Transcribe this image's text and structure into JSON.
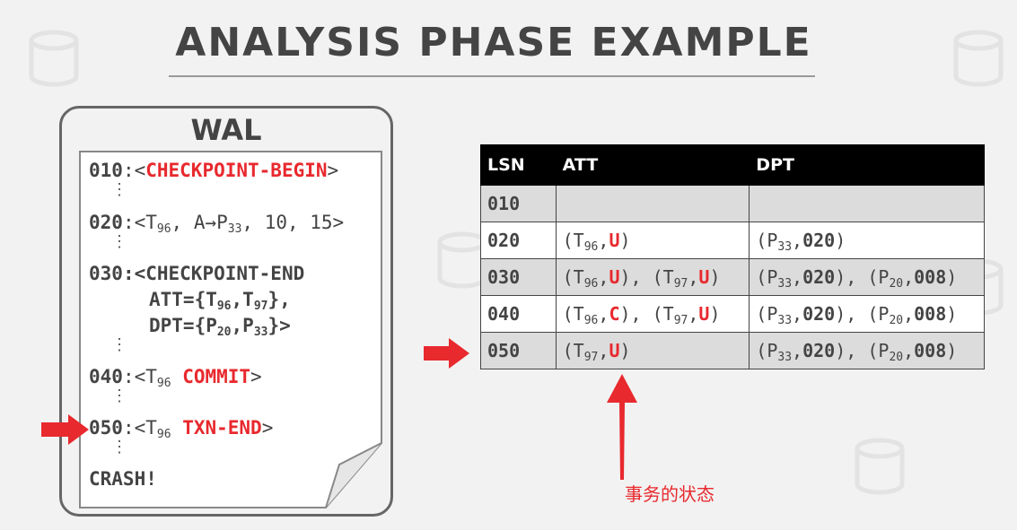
{
  "title": "ANALYSIS PHASE EXAMPLE",
  "wal": {
    "title": "WAL",
    "dots": "⋮",
    "lines": {
      "l010_lsn": "010",
      "l010_pre": ":<",
      "l010_red": "CHECKPOINT-BEGIN",
      "l010_post": ">",
      "l020_lsn": "020",
      "l020_a": ":<T",
      "l020_sub1": "96",
      "l020_b": ", A→P",
      "l020_sub2": "33",
      "l020_c": ", 10, 15>",
      "l030_lsn": "030",
      "l030_a": ":<CHECKPOINT-END",
      "l030_att": "ATT={T",
      "l030_att_s1": "96",
      "l030_att_m": ",T",
      "l030_att_s2": "97",
      "l030_att_e": "},",
      "l030_dpt": "DPT={P",
      "l030_dpt_s1": "20",
      "l030_dpt_m": ",P",
      "l030_dpt_s2": "33",
      "l030_dpt_e": "}>",
      "l040_lsn": "040",
      "l040_a": ":<T",
      "l040_sub": "96",
      "l040_red": "COMMIT",
      "l040_post": ">",
      "l050_lsn": "050",
      "l050_a": ":<T",
      "l050_sub": "96",
      "l050_red": "TXN-END",
      "l050_post": ">",
      "crash": "CRASH!"
    }
  },
  "table": {
    "headers": [
      "LSN",
      "ATT",
      "DPT"
    ],
    "rows": [
      {
        "lsn": "010"
      },
      {
        "lsn": "020"
      },
      {
        "lsn": "030"
      },
      {
        "lsn": "040"
      },
      {
        "lsn": "050"
      }
    ],
    "t": {
      "open": "(T",
      "close": ")",
      "comma": ",",
      "sep": "), (T",
      "p_open": "(P",
      "p_sep": "), (P",
      "s96": "96",
      "s97": "97",
      "s33": "33",
      "s20": "20",
      "u": "U",
      "c": "C",
      "v020": "020",
      "v008": "008"
    }
  },
  "annotation": "事务的状态",
  "colors": {
    "accent": "#e8292e",
    "header_bg": "#000000",
    "row_gray": "#dcdcdc"
  }
}
